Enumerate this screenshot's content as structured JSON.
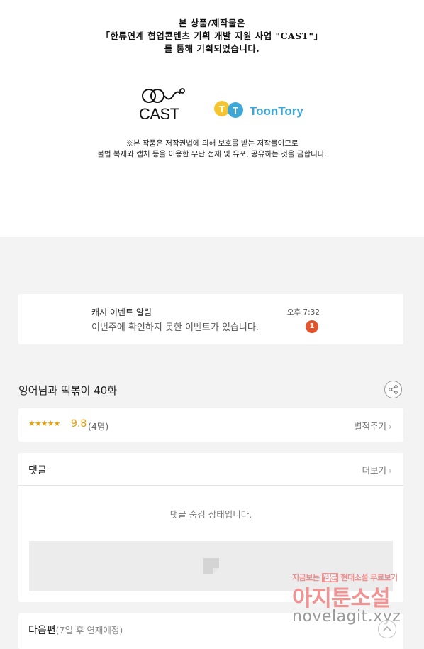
{
  "notice": {
    "lines": [
      "본 상품/제작물은",
      "「한류연계 협업콘텐츠 기획 개발 지원 사업 \"CAST\"」",
      "를 통해 기획되었습니다."
    ],
    "logos": [
      {
        "name": "CAST",
        "icon": "cast-logo"
      },
      {
        "name": "ToonTory",
        "icon": "toontory-logo"
      }
    ],
    "copyright": [
      "※본 작품은 저작권법에 의해 보호를 받는 저작물이므로",
      "불법 복제와 캡처 등을 이용한 무단 전재 및 유포, 공유하는 것을 금합니다."
    ]
  },
  "push_card": {
    "title": "캐시 이벤트 알림",
    "message": "이번주에 확인하지 못한 이벤트가 있습니다.",
    "time": "오후 7:32",
    "badge_count": "1",
    "badge_color": "#e2542d"
  },
  "episode": {
    "title": "잉어님과 떡볶이 40화",
    "share_icon": "share-icon"
  },
  "rating": {
    "stars": "★★★★★",
    "score": "9.8",
    "count": "(4명)",
    "rate_label": "별점주기",
    "star_color": "#e8a10c"
  },
  "comments": {
    "header": "댓글",
    "more_label": "더보기",
    "hidden_message": "댓글 숨김 상태입니다."
  },
  "next": {
    "label": "다음편",
    "sub": "(7일 후 연재예정)"
  },
  "watermark": {
    "top_prefix": "지금보는 ",
    "top_highlight": "웹툰",
    "top_suffix": " 현대소설 무료보기",
    "main": "아지툰소설",
    "url": "novelagit.xyz"
  }
}
